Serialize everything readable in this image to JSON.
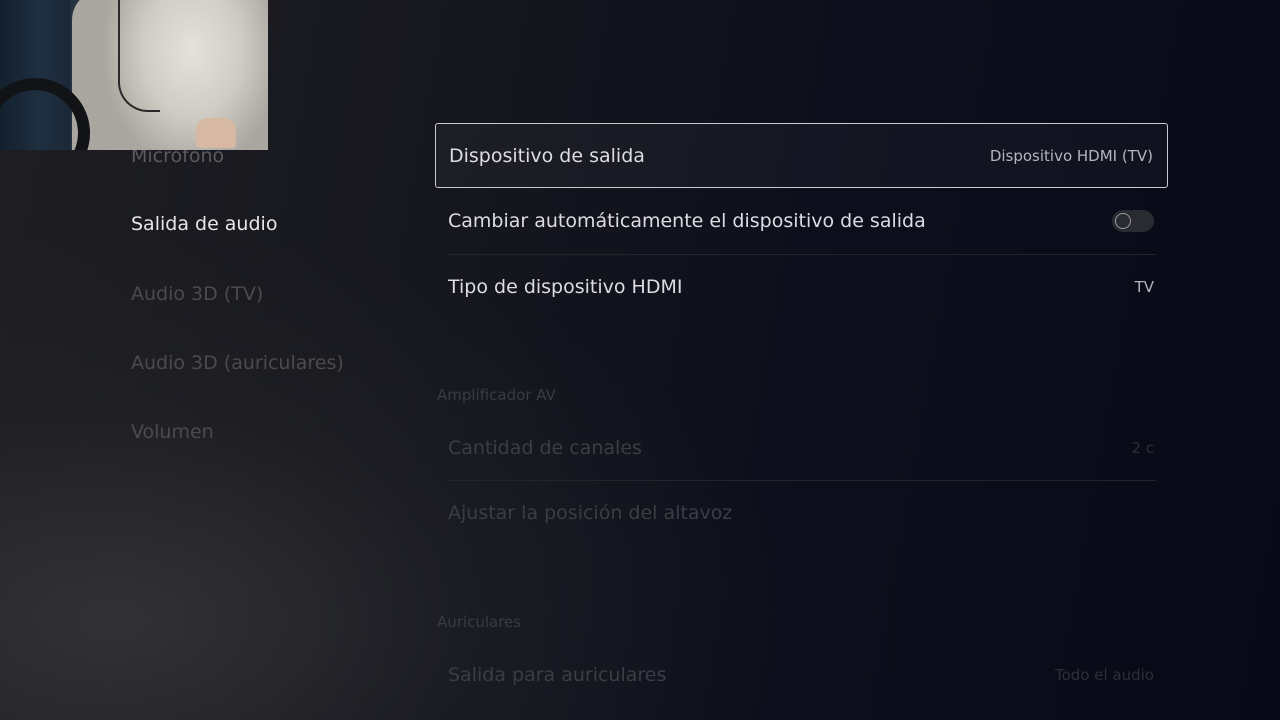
{
  "nav": {
    "items": [
      {
        "label": "Micrófono"
      },
      {
        "label": "Salida de audio"
      },
      {
        "label": "Audio 3D (TV)"
      },
      {
        "label": "Audio 3D (auriculares)"
      },
      {
        "label": "Volumen"
      }
    ]
  },
  "main": {
    "output_device": {
      "label": "Dispositivo de salida",
      "value": "Dispositivo HDMI (TV)"
    },
    "auto_switch": {
      "label": "Cambiar automáticamente el dispositivo de salida",
      "toggle_on": false
    },
    "hdmi_type": {
      "label": "Tipo de dispositivo HDMI",
      "value": "TV"
    },
    "av_amplifier": {
      "title": "Amplificador AV",
      "channels": {
        "label": "Cantidad de canales",
        "value": "2 c"
      },
      "speaker_position": {
        "label": "Ajustar la posición del altavoz"
      }
    },
    "headphones": {
      "title": "Auriculares",
      "output": {
        "label": "Salida para auriculares",
        "value": "Todo el audio"
      }
    }
  }
}
